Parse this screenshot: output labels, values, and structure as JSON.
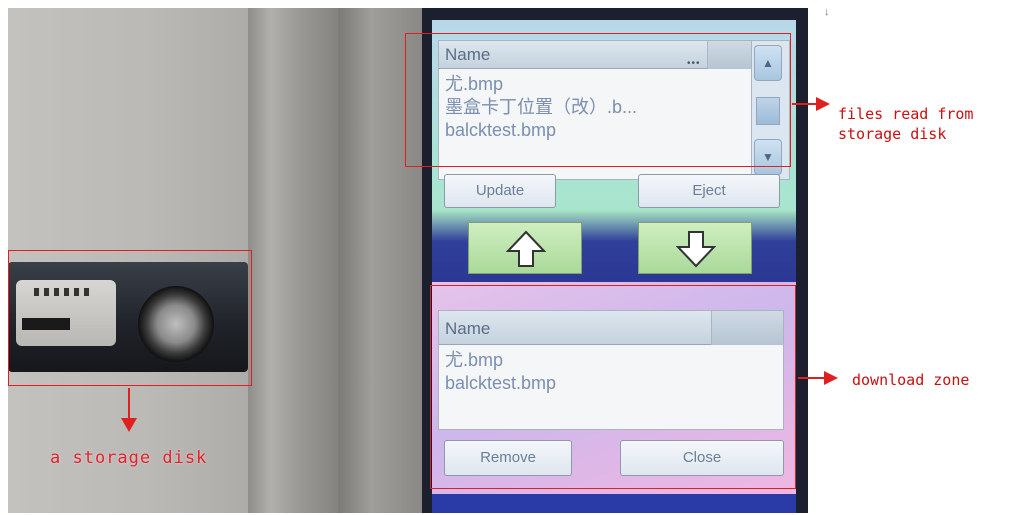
{
  "annotations": {
    "files_label": "files read from\nstorage disk",
    "download_label": "download zone",
    "disk_label": "a storage disk",
    "stray_mark": "↓"
  },
  "top_list": {
    "header": "Name",
    "rows": [
      "尤.bmp",
      "墨盒卡丁位置（改）.b...",
      "balcktest.bmp"
    ]
  },
  "buttons": {
    "update": "Update",
    "eject": "Eject",
    "remove": "Remove",
    "close": "Close"
  },
  "bottom_list": {
    "header": "Name",
    "rows": [
      "尤.bmp",
      "balcktest.bmp"
    ]
  },
  "icons": {
    "scroll_up": "chevron-up-icon",
    "scroll_down": "chevron-down-icon",
    "move_up": "arrow-up-icon",
    "move_down": "arrow-down-icon"
  },
  "colors": {
    "annotation": "#e02020",
    "list_text": "#7b8fb0",
    "arrow_fill": "#ffffff"
  }
}
